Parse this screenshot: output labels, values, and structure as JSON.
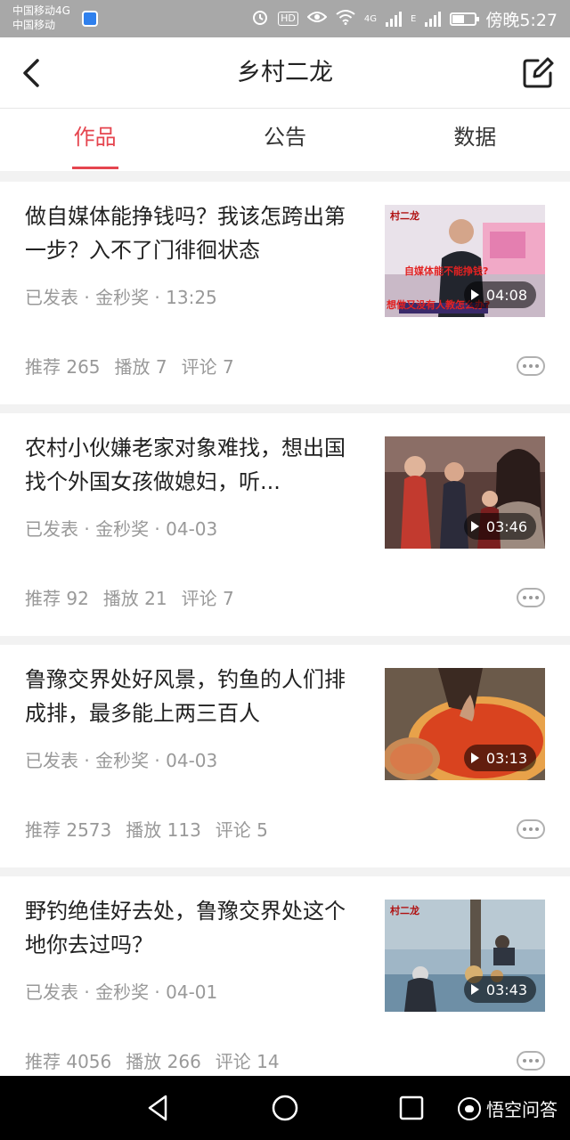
{
  "status_bar": {
    "carrier_line1": "中国移动4G",
    "carrier_line2": "中国移动",
    "hd": "HD",
    "net_4g": "4G",
    "net_e": "E",
    "battery_level": 0.55,
    "time": "傍晚5:27"
  },
  "header": {
    "title": "乡村二龙",
    "back_icon": "chevron-left-icon",
    "edit_icon": "edit-icon"
  },
  "tabs": [
    {
      "label": "作品",
      "active": true
    },
    {
      "label": "公告",
      "active": false
    },
    {
      "label": "数据",
      "active": false
    }
  ],
  "articles": [
    {
      "title": "做自媒体能挣钱吗？我该怎跨出第一步？入不了门徘徊状态",
      "meta": "已发表 · 金秒奖 · 13:25",
      "duration": "04:08",
      "stats": [
        "推荐 265",
        "播放 7",
        "评论 7"
      ],
      "thumb_brand": "村二龙",
      "thumb_caption1": "自媒体能不能挣钱?",
      "thumb_caption2": "想做又没有人教怎么办?"
    },
    {
      "title": "农村小伙嫌老家对象难找，想出国找个外国女孩做媳妇，听...",
      "meta": "已发表 · 金秒奖 · 04-03",
      "duration": "03:46",
      "stats": [
        "推荐 92",
        "播放 21",
        "评论 7"
      ]
    },
    {
      "title": "鲁豫交界处好风景，钓鱼的人们排成排，最多能上两三百人",
      "meta": "已发表 · 金秒奖 · 04-03",
      "duration": "03:13",
      "stats": [
        "推荐 2573",
        "播放 113",
        "评论 5"
      ]
    },
    {
      "title": "野钓绝佳好去处，鲁豫交界处这个地你去过吗？",
      "meta": "已发表 · 金秒奖 · 04-01",
      "duration": "03:43",
      "stats": [
        "推荐 4056",
        "播放 266",
        "评论 14"
      ],
      "thumb_brand": "村二龙"
    }
  ],
  "nav": {
    "back_icon": "triangle-back-icon",
    "home_icon": "circle-home-icon",
    "recent_icon": "square-recent-icon"
  },
  "watermark": "悟空问答"
}
